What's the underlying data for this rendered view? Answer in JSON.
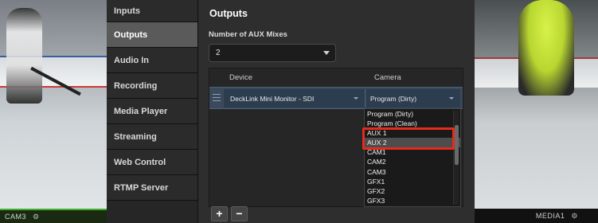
{
  "background": {
    "left_camera_label": "CAM3",
    "right_camera_label": "MEDIA1",
    "gear_icon_glyph": "⚙"
  },
  "sidebar": {
    "items": [
      {
        "label": "Inputs"
      },
      {
        "label": "Outputs",
        "active": true
      },
      {
        "label": "Audio In"
      },
      {
        "label": "Recording"
      },
      {
        "label": "Media Player"
      },
      {
        "label": "Streaming"
      },
      {
        "label": "Web Control"
      },
      {
        "label": "RTMP Server"
      }
    ]
  },
  "main": {
    "title": "Outputs",
    "aux_mixes": {
      "label": "Number of AUX Mixes",
      "value": "2"
    },
    "table": {
      "columns": [
        "Device",
        "Camera"
      ],
      "rows": [
        {
          "device": "DeckLink Mini Monitor - SDI",
          "camera": "Program (Dirty)"
        }
      ]
    },
    "camera_dropdown": {
      "options": [
        "Program (Dirty)",
        "Program (Clean)",
        "AUX 1",
        "AUX 2",
        "CAM1",
        "CAM2",
        "CAM3",
        "GFX1",
        "GFX2",
        "GFX3"
      ],
      "selected": "AUX 2",
      "highlighted": [
        "AUX 1",
        "AUX 2"
      ],
      "highlight_color": "#e52a1e"
    },
    "buttons": {
      "add": "+",
      "remove": "−"
    }
  },
  "colors": {
    "active_sidebar": "#5a5a5a",
    "row_selected": "#3a4a5c",
    "live_indicator": "#3fae2a"
  }
}
